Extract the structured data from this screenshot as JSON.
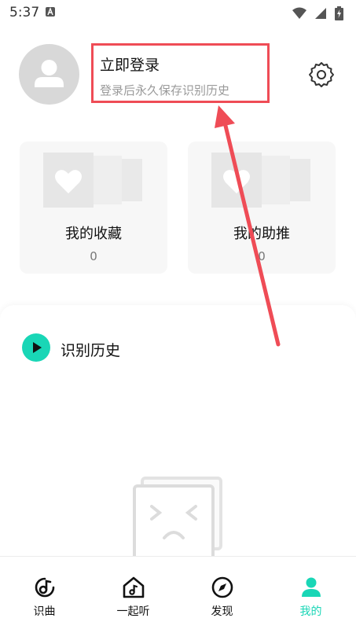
{
  "status_bar": {
    "time": "5:37",
    "notification_icon": "a-app-icon",
    "icons": [
      "wifi-icon",
      "signal-icon",
      "battery-charging-icon"
    ]
  },
  "profile": {
    "login_title": "立即登录",
    "login_subtitle": "登录后永久保存识别历史",
    "avatar_icon": "user-avatar-icon",
    "settings_icon": "gear-icon"
  },
  "cards": [
    {
      "label": "我的收藏",
      "count": "0",
      "icon": "heart-icon"
    },
    {
      "label": "我的助推",
      "count": "0",
      "icon": "heart-icon"
    }
  ],
  "history": {
    "title": "识别历史",
    "icon": "play-icon",
    "empty_icon": "sad-face-box-icon"
  },
  "bottom_nav": {
    "items": [
      {
        "label": "识曲",
        "icon": "music-note-disc-icon"
      },
      {
        "label": "一起听",
        "icon": "house-music-icon"
      },
      {
        "label": "发现",
        "icon": "compass-icon"
      },
      {
        "label": "我的",
        "icon": "person-icon"
      }
    ],
    "active_index": 3
  },
  "colors": {
    "accent": "#19d6b6",
    "annotation": "#ef4c56",
    "card_bg": "#f7f7f7",
    "avatar_bg": "#d8d8d8"
  }
}
